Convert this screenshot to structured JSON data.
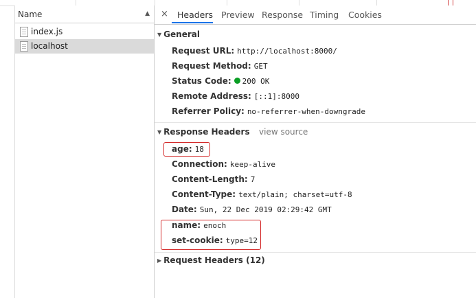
{
  "name_panel": {
    "header": "Name",
    "sort_icon": "sort-ascending-icon",
    "files": [
      {
        "name": "index.js",
        "selected": false
      },
      {
        "name": "localhost",
        "selected": true
      }
    ]
  },
  "tabs": [
    "Headers",
    "Preview",
    "Response",
    "Timing",
    "Cookies"
  ],
  "active_tab": "Headers",
  "close_symbol": "×",
  "general": {
    "title": "General",
    "request_url": {
      "key": "Request URL:",
      "value": "http://localhost:8000/"
    },
    "request_method": {
      "key": "Request Method:",
      "value": "GET"
    },
    "status_code": {
      "key": "Status Code:",
      "value": "200 OK",
      "status_color": "#0a9e24"
    },
    "remote_address": {
      "key": "Remote Address:",
      "value": "[::1]:8000"
    },
    "referrer_policy": {
      "key": "Referrer Policy:",
      "value": "no-referrer-when-downgrade"
    }
  },
  "response_headers": {
    "title": "Response Headers",
    "view_source": "view source",
    "items": {
      "age": {
        "key": "age:",
        "value": "18"
      },
      "connection": {
        "key": "Connection:",
        "value": "keep-alive"
      },
      "content_length": {
        "key": "Content-Length:",
        "value": "7"
      },
      "content_type": {
        "key": "Content-Type:",
        "value": "text/plain; charset=utf-8"
      },
      "date": {
        "key": "Date:",
        "value": "Sun, 22 Dec 2019 02:29:42 GMT"
      },
      "name": {
        "key": "name:",
        "value": "enoch"
      },
      "set_cookie": {
        "key": "set-cookie:",
        "value": "type=12"
      }
    }
  },
  "request_headers": {
    "title": "Request Headers (12)"
  },
  "colors": {
    "highlight_border": "#d42a2a",
    "active_tab_underline": "#1a73e8",
    "selected_row": "#dadada"
  }
}
